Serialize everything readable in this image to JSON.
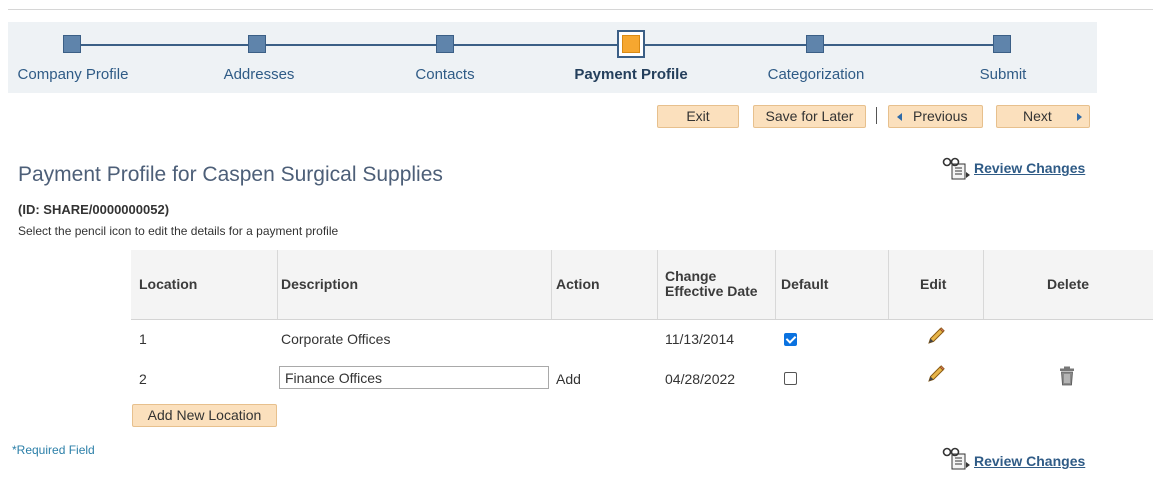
{
  "steps": [
    {
      "label": "Company Profile",
      "current": false
    },
    {
      "label": "Addresses",
      "current": false
    },
    {
      "label": "Contacts",
      "current": false
    },
    {
      "label": "Payment Profile",
      "current": true
    },
    {
      "label": "Categorization",
      "current": false
    },
    {
      "label": "Submit",
      "current": false
    }
  ],
  "toolbar": {
    "exit": "Exit",
    "save_for_later": "Save for Later",
    "previous": "Previous",
    "next": "Next"
  },
  "page": {
    "title": "Payment Profile for Caspen Surgical Supplies",
    "id_line": "(ID: SHARE/0000000052)",
    "instructions": "Select the pencil icon to edit the details for a payment profile",
    "review_changes": "Review Changes",
    "review_icon": "review-glasses-icon",
    "required_field": "*Required Field",
    "add_location": "Add New Location"
  },
  "table": {
    "headers": {
      "location": "Location",
      "description": "Description",
      "action": "Action",
      "change_line1": "Change",
      "change_line2": "Effective Date",
      "default": "Default",
      "edit": "Edit",
      "delete": "Delete"
    },
    "rows": [
      {
        "location": "1",
        "description": "Corporate Offices",
        "action": "",
        "date": "11/13/2014",
        "default": true,
        "editable_description": false,
        "deletable": false
      },
      {
        "location": "2",
        "description": "Finance Offices",
        "action": "Add",
        "date": "04/28/2022",
        "default": false,
        "editable_description": true,
        "deletable": true
      }
    ]
  },
  "colors": {
    "accent_link": "#2f5b86",
    "button_bg": "#fbe0bd",
    "current_step": "#f6a730",
    "step_node": "#5f84ab"
  }
}
